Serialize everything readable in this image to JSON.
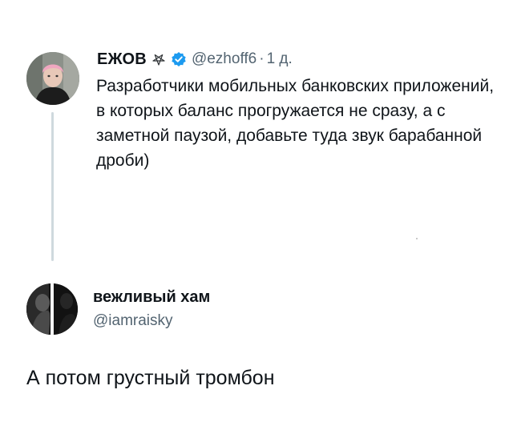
{
  "tweet": {
    "author_name": "ЕЖОВ",
    "author_handle": "@ezhoff6",
    "separator": "·",
    "time": "1 д.",
    "text": "Разработчики мобильных банковских приложений, в которых баланс прогружается не сразу, а с заметной паузой, добавьте туда звук барабанной дроби)",
    "icons": [
      "pentagram-icon",
      "verified-badge-icon"
    ]
  },
  "reply": {
    "author_name": "вежливый хам",
    "author_handle": "@iamraisky",
    "text": "А потом грустный тромбон"
  },
  "colors": {
    "text": "#0f1419",
    "secondary": "#536471",
    "verified": "#1d9bf0",
    "thread_line": "#cfd9de"
  }
}
